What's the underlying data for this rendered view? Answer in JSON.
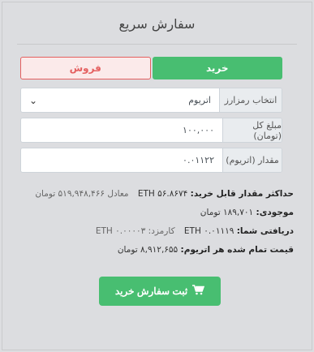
{
  "header": {
    "title": "سفارش سریع"
  },
  "tabs": {
    "buy": "خرید",
    "sell": "فروش"
  },
  "form": {
    "currency": {
      "label": "انتخاب رمزارز",
      "value": "اتریوم"
    },
    "total": {
      "label": "مبلغ کل (تومان)",
      "value": "۱۰۰,۰۰۰"
    },
    "amount": {
      "label": "مقدار (اتریوم)",
      "value": "۰.۰۱۱۲۲"
    }
  },
  "info": {
    "max": {
      "label": "حداکثر مقدار قابل خرید:",
      "value": "ETH ۵۶.۸۶۷۴",
      "equiv": "معادل ۵۱۹,۹۴۸,۴۶۶ تومان"
    },
    "balance": {
      "label": "موجودی:",
      "value": "۱۸۹,۷۰۱ تومان"
    },
    "receive": {
      "label": "دریافتی شما:",
      "value": "ETH ۰.۰۱۱۱۹",
      "fee": "کارمزد: ETH ۰.۰۰۰۰۳"
    },
    "price": {
      "label": "قیمت تمام شده هر اتریوم:",
      "value": "۸,۹۱۲,۶۵۵ تومان"
    }
  },
  "submit": {
    "label": "ثبت سفارش خرید",
    "icon": "shopping-cart-icon"
  },
  "colors": {
    "buy": "#48be71",
    "sell": "#e46060"
  }
}
